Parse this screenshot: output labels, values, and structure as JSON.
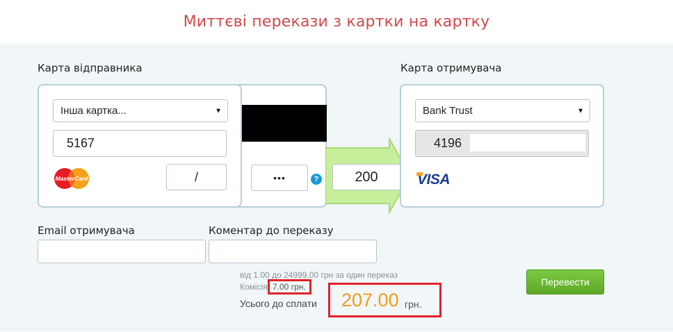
{
  "header": {
    "title": "Миттєві перекази з картки на картку"
  },
  "sender": {
    "label": "Карта відправника",
    "card_select": "Інша картка...",
    "card_number": "5167",
    "expiry": "/",
    "cvv": "•••",
    "help": "?",
    "logo_text": "MasterCard"
  },
  "amount": {
    "value": "200"
  },
  "receiver": {
    "label": "Карта отримувача",
    "bank_select": "Bank Trust",
    "card_number": "4196",
    "logo_text": "VISA"
  },
  "email": {
    "label": "Email отримувача",
    "value": ""
  },
  "comment": {
    "label": "Коментар до переказу",
    "value": ""
  },
  "limits": {
    "range_text": "від 1.00 до 24999.00 грн за один переказ",
    "commission_label": "Комісія",
    "commission_value": "7.00 грн."
  },
  "total": {
    "label": "Усього до сплати",
    "value": "207.00",
    "currency": "грн."
  },
  "submit": {
    "label": "Перевести"
  },
  "colors": {
    "title": "#d2484a",
    "accent_total": "#f39a1e",
    "button": "#6bb734",
    "arrow": "#c7ee9b",
    "highlight_box": "#e0232a"
  }
}
